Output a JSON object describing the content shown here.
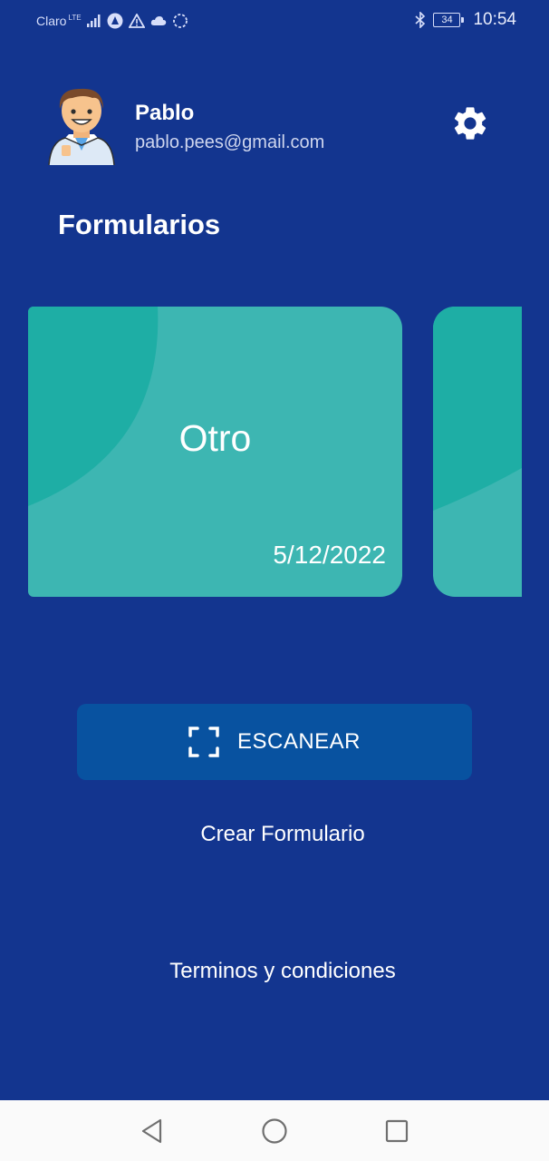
{
  "status_bar": {
    "carrier": "Claro",
    "network": "LTE",
    "battery": "34",
    "time": "10:54"
  },
  "profile": {
    "name": "Pablo",
    "email": "pablo.pees@gmail.com",
    "settings_icon": "gear-icon"
  },
  "section_title": "Formularios",
  "cards": [
    {
      "title": "Otro",
      "date": "5/12/2022"
    }
  ],
  "actions": {
    "scan_label": "ESCANEAR",
    "create_label": "Crear Formulario",
    "terms_label": "Terminos y condiciones"
  },
  "colors": {
    "background": "#13358f",
    "card": "#3db6b2",
    "card_accent": "#1eaea5",
    "button": "#0852a0"
  }
}
